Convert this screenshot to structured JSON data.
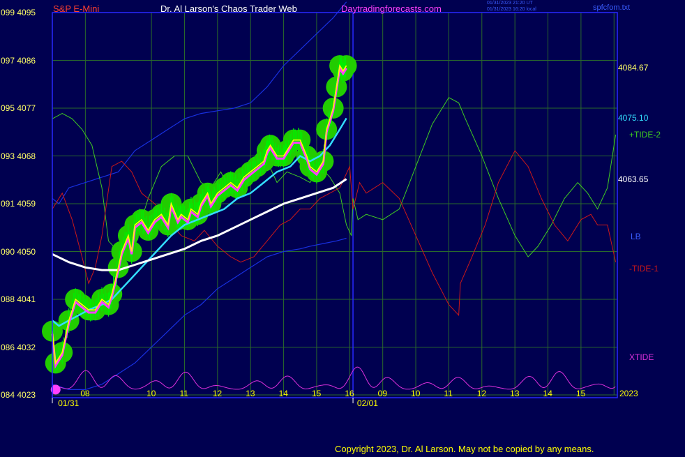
{
  "header": {
    "instrument": "S&P E-Mini",
    "site_title": "Dr. Al Larson's Chaos Trader Web",
    "site_url": "Daytradingforecasts.com",
    "timestamp_1": "01/31/2023 21:20 UT",
    "timestamp_2": "01/31/2023 16:20 local",
    "file_name": "spfcfom.txt"
  },
  "footer": {
    "copyright": "Copyright 2023, Dr. Al Larson. May not be copied by any means."
  },
  "colors": {
    "background": "#000050",
    "plot_border": "#2828ff",
    "grid": "#2a6a2a",
    "price_yellow": "#ffff00",
    "price_magenta": "#ff40ff",
    "price_halo": "#22cc00",
    "bar_green": "#00ee00",
    "cyan_avg": "#33ddff",
    "white_avg": "#ffffff",
    "band_blue": "#1830e0",
    "tide_plus2": "#40cc20",
    "tide_minus1": "#cc1818",
    "xtide": "#dd30dd"
  },
  "chart_data": {
    "type": "line",
    "title": "S&P E-Mini",
    "y_left_labels": [
      "099 4095",
      "097 4086",
      "095 4077",
      "093 4068",
      "091 4059",
      "090 4050",
      "088 4041",
      "086 4032",
      "084 4023"
    ],
    "y_right_labels": [
      {
        "label": "4084.67",
        "color": "#ffff66",
        "price": 4084.67
      },
      {
        "label": "4075.10",
        "color": "#33ddff",
        "price": 4075.1
      },
      {
        "label": "+TIDE-2",
        "color": "#40cc20"
      },
      {
        "label": "4063.65",
        "color": "#ffffff",
        "price": 4063.65
      },
      {
        "label": "LB",
        "color": "#3a5cff"
      },
      {
        "label": "-TIDE-1",
        "color": "#cc1818"
      },
      {
        "label": "XTIDE",
        "color": "#dd30dd"
      }
    ],
    "ylim": [
      4023,
      4095
    ],
    "x_hours": [
      "08",
      "10",
      "11",
      "12",
      "13",
      "14",
      "15",
      "16",
      "09",
      "10",
      "11",
      "12",
      "13",
      "14",
      "15",
      "16"
    ],
    "x_hour_positions": [
      7.5,
      9.5,
      10.5,
      11.5,
      12.5,
      13.5,
      14.5,
      15.5,
      16.5,
      17.5,
      18.5,
      19.5,
      20.5,
      21.5,
      22.5,
      23.5
    ],
    "x_dates": [
      {
        "label": "01/31",
        "hour": 6.8
      },
      {
        "label": "02/01",
        "hour": 15.85
      }
    ],
    "year_label": "2023",
    "xlim": [
      6.5,
      22.0
    ],
    "session_divider_hour": 15.6,
    "series": [
      {
        "name": "price",
        "color": "#ffff00",
        "points": [
          [
            6.5,
            4035
          ],
          [
            6.6,
            4029
          ],
          [
            6.8,
            4031
          ],
          [
            7.0,
            4037
          ],
          [
            7.2,
            4041
          ],
          [
            7.4,
            4040
          ],
          [
            7.6,
            4039
          ],
          [
            7.8,
            4039
          ],
          [
            8.0,
            4041
          ],
          [
            8.2,
            4040
          ],
          [
            8.3,
            4042
          ],
          [
            8.5,
            4047
          ],
          [
            8.6,
            4050
          ],
          [
            8.8,
            4053
          ],
          [
            8.9,
            4050
          ],
          [
            9.0,
            4055
          ],
          [
            9.2,
            4056
          ],
          [
            9.4,
            4054
          ],
          [
            9.6,
            4056
          ],
          [
            9.8,
            4057
          ],
          [
            10.0,
            4055
          ],
          [
            10.1,
            4059
          ],
          [
            10.3,
            4056
          ],
          [
            10.4,
            4057
          ],
          [
            10.6,
            4056
          ],
          [
            10.7,
            4058
          ],
          [
            10.9,
            4057
          ],
          [
            11.0,
            4059
          ],
          [
            11.2,
            4061
          ],
          [
            11.3,
            4059
          ],
          [
            11.5,
            4061
          ],
          [
            11.7,
            4062
          ],
          [
            11.9,
            4063
          ],
          [
            12.1,
            4062
          ],
          [
            12.3,
            4064
          ],
          [
            12.5,
            4065
          ],
          [
            12.7,
            4066
          ],
          [
            12.9,
            4067
          ],
          [
            13.0,
            4069
          ],
          [
            13.1,
            4070
          ],
          [
            13.3,
            4068
          ],
          [
            13.5,
            4068
          ],
          [
            13.6,
            4069
          ],
          [
            13.8,
            4071
          ],
          [
            14.0,
            4071
          ],
          [
            14.2,
            4068
          ],
          [
            14.3,
            4066
          ],
          [
            14.5,
            4065
          ],
          [
            14.7,
            4067
          ],
          [
            14.8,
            4073
          ],
          [
            15.0,
            4077
          ],
          [
            15.1,
            4081
          ],
          [
            15.2,
            4085
          ],
          [
            15.3,
            4084
          ],
          [
            15.4,
            4085
          ]
        ]
      },
      {
        "name": "cyan average",
        "color": "#33ddff",
        "points": [
          [
            6.5,
            4037
          ],
          [
            6.7,
            4036
          ],
          [
            7.0,
            4037
          ],
          [
            7.3,
            4038
          ],
          [
            7.6,
            4039
          ],
          [
            8.0,
            4040
          ],
          [
            8.3,
            4041
          ],
          [
            8.6,
            4043
          ],
          [
            8.9,
            4045
          ],
          [
            9.2,
            4047
          ],
          [
            9.5,
            4049
          ],
          [
            9.8,
            4051
          ],
          [
            10.1,
            4053
          ],
          [
            10.5,
            4055
          ],
          [
            10.9,
            4056
          ],
          [
            11.3,
            4057
          ],
          [
            11.7,
            4058
          ],
          [
            12.1,
            4060
          ],
          [
            12.5,
            4061
          ],
          [
            12.9,
            4063
          ],
          [
            13.3,
            4065
          ],
          [
            13.7,
            4066
          ],
          [
            14.0,
            4068
          ],
          [
            14.3,
            4067
          ],
          [
            14.6,
            4068
          ],
          [
            14.9,
            4070
          ],
          [
            15.2,
            4073
          ],
          [
            15.4,
            4075.1
          ]
        ]
      },
      {
        "name": "white average",
        "color": "#ffffff",
        "points": [
          [
            6.5,
            4049.5
          ],
          [
            7.0,
            4048
          ],
          [
            7.5,
            4047
          ],
          [
            8.0,
            4046.5
          ],
          [
            8.5,
            4046.5
          ],
          [
            9.0,
            4047.5
          ],
          [
            9.5,
            4048.5
          ],
          [
            10.0,
            4049.5
          ],
          [
            10.5,
            4050.5
          ],
          [
            11.0,
            4052
          ],
          [
            11.5,
            4053
          ],
          [
            12.0,
            4054.5
          ],
          [
            12.5,
            4056
          ],
          [
            13.0,
            4057.5
          ],
          [
            13.5,
            4059
          ],
          [
            14.0,
            4060
          ],
          [
            14.5,
            4061
          ],
          [
            15.0,
            4062
          ],
          [
            15.4,
            4063.65
          ]
        ]
      },
      {
        "name": "LB",
        "color": "#1830e0",
        "points": [
          [
            6.5,
            4025
          ],
          [
            7.0,
            4024
          ],
          [
            7.5,
            4024
          ],
          [
            8.0,
            4025
          ],
          [
            8.5,
            4027
          ],
          [
            9.0,
            4029
          ],
          [
            9.5,
            4032
          ],
          [
            10.0,
            4035
          ],
          [
            10.5,
            4038
          ],
          [
            11.0,
            4040
          ],
          [
            11.5,
            4043
          ],
          [
            12.0,
            4045
          ],
          [
            12.5,
            4047
          ],
          [
            13.0,
            4049
          ],
          [
            13.5,
            4050
          ],
          [
            14.0,
            4050.5
          ],
          [
            14.3,
            4051
          ],
          [
            14.7,
            4051.5
          ],
          [
            15.1,
            4052
          ],
          [
            15.4,
            4052.5
          ]
        ]
      },
      {
        "name": "upper band",
        "color": "#1830e0",
        "points": [
          [
            6.5,
            4060
          ],
          [
            6.7,
            4059
          ],
          [
            7.0,
            4062
          ],
          [
            7.5,
            4063
          ],
          [
            8.0,
            4064
          ],
          [
            8.5,
            4065
          ],
          [
            9.0,
            4069
          ],
          [
            9.5,
            4071
          ],
          [
            10.0,
            4073
          ],
          [
            10.5,
            4075
          ],
          [
            11.0,
            4076
          ],
          [
            11.5,
            4076.5
          ],
          [
            12.0,
            4077
          ],
          [
            12.5,
            4078
          ],
          [
            13.0,
            4081
          ],
          [
            13.5,
            4085
          ],
          [
            14.0,
            4088
          ],
          [
            14.5,
            4091
          ],
          [
            15.0,
            4094
          ],
          [
            15.4,
            4097
          ]
        ]
      },
      {
        "name": "+TIDE-2",
        "color": "#40cc20",
        "points": [
          [
            6.5,
            4075
          ],
          [
            6.8,
            4076
          ],
          [
            7.1,
            4075
          ],
          [
            7.4,
            4073
          ],
          [
            7.7,
            4070
          ],
          [
            8.0,
            4062
          ],
          [
            8.2,
            4052
          ],
          [
            8.5,
            4050
          ],
          [
            8.8,
            4051
          ],
          [
            9.1,
            4054
          ],
          [
            9.4,
            4060
          ],
          [
            9.8,
            4066
          ],
          [
            10.2,
            4068
          ],
          [
            10.6,
            4068
          ],
          [
            11.0,
            4063
          ],
          [
            11.3,
            4062
          ],
          [
            11.6,
            4065
          ],
          [
            11.9,
            4061
          ],
          [
            12.2,
            4063
          ],
          [
            12.6,
            4064
          ],
          [
            13.0,
            4067
          ],
          [
            13.3,
            4063
          ],
          [
            13.6,
            4065
          ],
          [
            14.0,
            4064
          ],
          [
            14.3,
            4063
          ],
          [
            14.6,
            4066
          ],
          [
            14.9,
            4064
          ],
          [
            15.2,
            4061
          ],
          [
            15.4,
            4055
          ],
          [
            15.55,
            4053
          ],
          [
            15.6,
            4060
          ],
          [
            15.75,
            4056
          ],
          [
            16.0,
            4057
          ],
          [
            16.5,
            4056
          ],
          [
            17.0,
            4058
          ],
          [
            17.5,
            4066
          ],
          [
            18.0,
            4074
          ],
          [
            18.5,
            4079
          ],
          [
            18.8,
            4078
          ],
          [
            19.0,
            4075
          ],
          [
            19.5,
            4068
          ],
          [
            20.0,
            4060
          ],
          [
            20.5,
            4053
          ],
          [
            20.9,
            4049
          ],
          [
            21.2,
            4051
          ],
          [
            21.6,
            4055
          ],
          [
            22.0,
            4060
          ],
          [
            22.4,
            4063
          ],
          [
            22.7,
            4061
          ],
          [
            23.0,
            4058
          ],
          [
            23.3,
            4062
          ],
          [
            23.55,
            4072
          ]
        ]
      },
      {
        "name": "-TIDE-1",
        "color": "#cc1818",
        "points": [
          [
            6.5,
            4058
          ],
          [
            6.8,
            4061
          ],
          [
            7.1,
            4056
          ],
          [
            7.4,
            4049
          ],
          [
            7.6,
            4044
          ],
          [
            7.8,
            4047
          ],
          [
            8.0,
            4053
          ],
          [
            8.3,
            4066
          ],
          [
            8.6,
            4067
          ],
          [
            8.9,
            4065
          ],
          [
            9.2,
            4061
          ],
          [
            9.6,
            4059
          ],
          [
            10.0,
            4056
          ],
          [
            10.4,
            4053
          ],
          [
            10.8,
            4052
          ],
          [
            11.1,
            4054
          ],
          [
            11.5,
            4051
          ],
          [
            11.9,
            4049
          ],
          [
            12.2,
            4048
          ],
          [
            12.6,
            4049
          ],
          [
            13.0,
            4052
          ],
          [
            13.4,
            4055
          ],
          [
            13.7,
            4056
          ],
          [
            14.0,
            4058
          ],
          [
            14.3,
            4058
          ],
          [
            14.6,
            4060
          ],
          [
            14.9,
            4061
          ],
          [
            15.2,
            4062
          ],
          [
            15.5,
            4066
          ],
          [
            15.6,
            4058
          ],
          [
            15.8,
            4063
          ],
          [
            16.0,
            4061
          ],
          [
            16.5,
            4063
          ],
          [
            17.0,
            4060
          ],
          [
            17.5,
            4053
          ],
          [
            18.0,
            4046
          ],
          [
            18.5,
            4040
          ],
          [
            18.8,
            4038
          ],
          [
            18.85,
            4044
          ],
          [
            19.2,
            4049
          ],
          [
            19.6,
            4055
          ],
          [
            20.0,
            4063
          ],
          [
            20.5,
            4069
          ],
          [
            20.9,
            4066
          ],
          [
            21.3,
            4060
          ],
          [
            21.7,
            4055
          ],
          [
            22.1,
            4052
          ],
          [
            22.5,
            4056
          ],
          [
            22.8,
            4057
          ],
          [
            23.0,
            4055
          ],
          [
            23.3,
            4055
          ],
          [
            23.55,
            4048
          ]
        ]
      }
    ],
    "xtide": {
      "name": "XTIDE",
      "color": "#dd30dd",
      "baseline": 4024,
      "amplitude": 4.5
    }
  }
}
